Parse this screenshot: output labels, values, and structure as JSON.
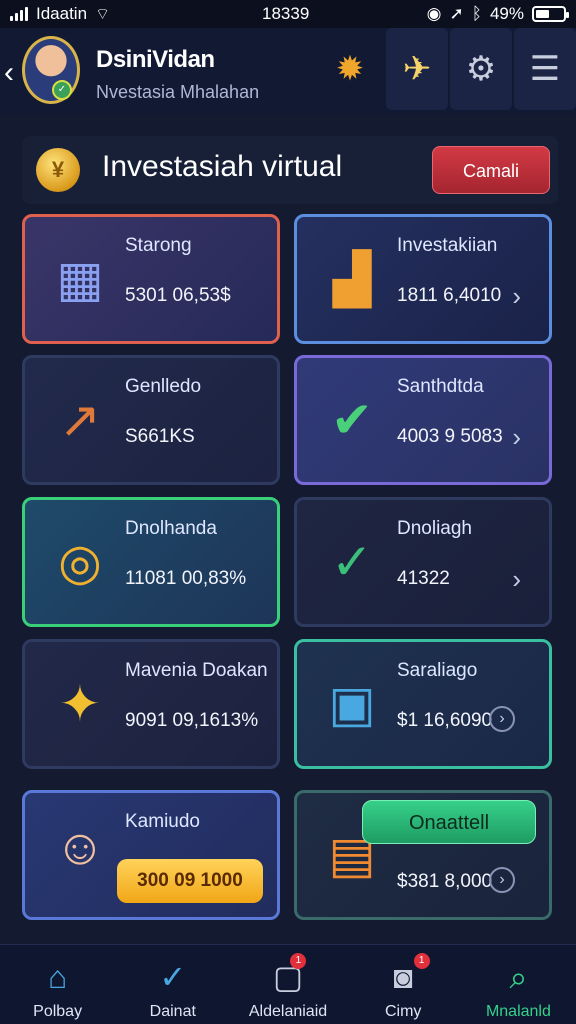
{
  "status": {
    "carrier": "Idaatin",
    "time": "18339",
    "battery": "49%",
    "battery_level": 0.49
  },
  "header": {
    "name": "DsiniVidan",
    "subtitle": "Nvestasia Mhalahan"
  },
  "banner": {
    "title": "Investasiah virtual",
    "button_label": "Camali"
  },
  "cards": [
    {
      "title": "Starong",
      "value": "5301 06,53$"
    },
    {
      "title": "Investakiian",
      "value": "1811 6,4010"
    },
    {
      "title": "Genlledo",
      "value": "S661KS"
    },
    {
      "title": "Santhdtda",
      "value": "4003 9 5083"
    },
    {
      "title": "Dnolhanda",
      "value": "11081 00,83%"
    },
    {
      "title": "Dnoliagh",
      "value": "41322"
    },
    {
      "title": "Mavenia Doakan",
      "value": "9091 09,1613%"
    },
    {
      "title": "Saraliago",
      "value": "$1 16,6090"
    },
    {
      "title": "Kamiudo",
      "value": "300 09 1000"
    },
    {
      "title": "",
      "value": "$381 8,000",
      "button_label": "Onaattell"
    }
  ],
  "tabs": [
    {
      "label": "Polbay",
      "icon": "home-icon",
      "color": "#4aa8e0"
    },
    {
      "label": "Dainat",
      "icon": "check-icon",
      "color": "#4aa8e0"
    },
    {
      "label": "Aldelaniaid",
      "icon": "document-icon",
      "color": "#c8cede",
      "badge": "1"
    },
    {
      "label": "Cimy",
      "icon": "camera-icon",
      "color": "#c8cede",
      "badge": "1"
    },
    {
      "label": "Mnalanld",
      "icon": "search-icon",
      "color": "#35d08a"
    }
  ]
}
